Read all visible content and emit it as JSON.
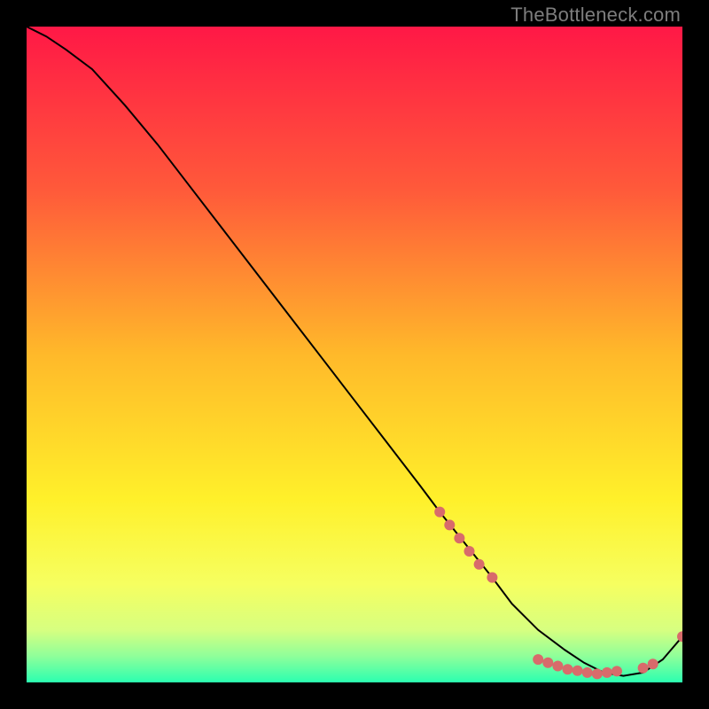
{
  "watermark": "TheBottleneck.com",
  "chart_data": {
    "type": "line",
    "title": "",
    "xlabel": "",
    "ylabel": "",
    "xlim": [
      0,
      100
    ],
    "ylim": [
      0,
      100
    ],
    "grid": false,
    "legend": false,
    "gradient_stops": [
      {
        "offset": 0.0,
        "color": "#ff1846"
      },
      {
        "offset": 0.25,
        "color": "#ff5a3a"
      },
      {
        "offset": 0.5,
        "color": "#ffb92a"
      },
      {
        "offset": 0.72,
        "color": "#fff02a"
      },
      {
        "offset": 0.85,
        "color": "#f6ff60"
      },
      {
        "offset": 0.92,
        "color": "#d7ff80"
      },
      {
        "offset": 0.96,
        "color": "#8fff9a"
      },
      {
        "offset": 1.0,
        "color": "#2bffb0"
      }
    ],
    "series": [
      {
        "name": "bottleneck-curve",
        "color": "#000000",
        "x": [
          0,
          3,
          6,
          10,
          15,
          20,
          25,
          30,
          35,
          40,
          45,
          50,
          55,
          60,
          63,
          67,
          71,
          74,
          78,
          82,
          85,
          88,
          91,
          94,
          97,
          100
        ],
        "y": [
          100,
          98.5,
          96.5,
          93.5,
          88,
          82,
          75.5,
          69,
          62.5,
          56,
          49.5,
          43,
          36.5,
          30,
          26,
          21,
          16,
          12,
          8,
          5,
          3,
          1.5,
          1,
          1.5,
          3.5,
          7
        ]
      }
    ],
    "markers": {
      "name": "highlight-points",
      "color": "#d86b6b",
      "radius_px": 6,
      "points": [
        {
          "x": 63,
          "y": 26
        },
        {
          "x": 64.5,
          "y": 24
        },
        {
          "x": 66,
          "y": 22
        },
        {
          "x": 67.5,
          "y": 20
        },
        {
          "x": 69,
          "y": 18
        },
        {
          "x": 71,
          "y": 16
        },
        {
          "x": 78,
          "y": 3.5
        },
        {
          "x": 79.5,
          "y": 3
        },
        {
          "x": 81,
          "y": 2.5
        },
        {
          "x": 82.5,
          "y": 2
        },
        {
          "x": 84,
          "y": 1.8
        },
        {
          "x": 85.5,
          "y": 1.5
        },
        {
          "x": 87,
          "y": 1.3
        },
        {
          "x": 88.5,
          "y": 1.5
        },
        {
          "x": 90,
          "y": 1.7
        },
        {
          "x": 94,
          "y": 2.2
        },
        {
          "x": 95.5,
          "y": 2.8
        },
        {
          "x": 100,
          "y": 7
        }
      ]
    }
  }
}
